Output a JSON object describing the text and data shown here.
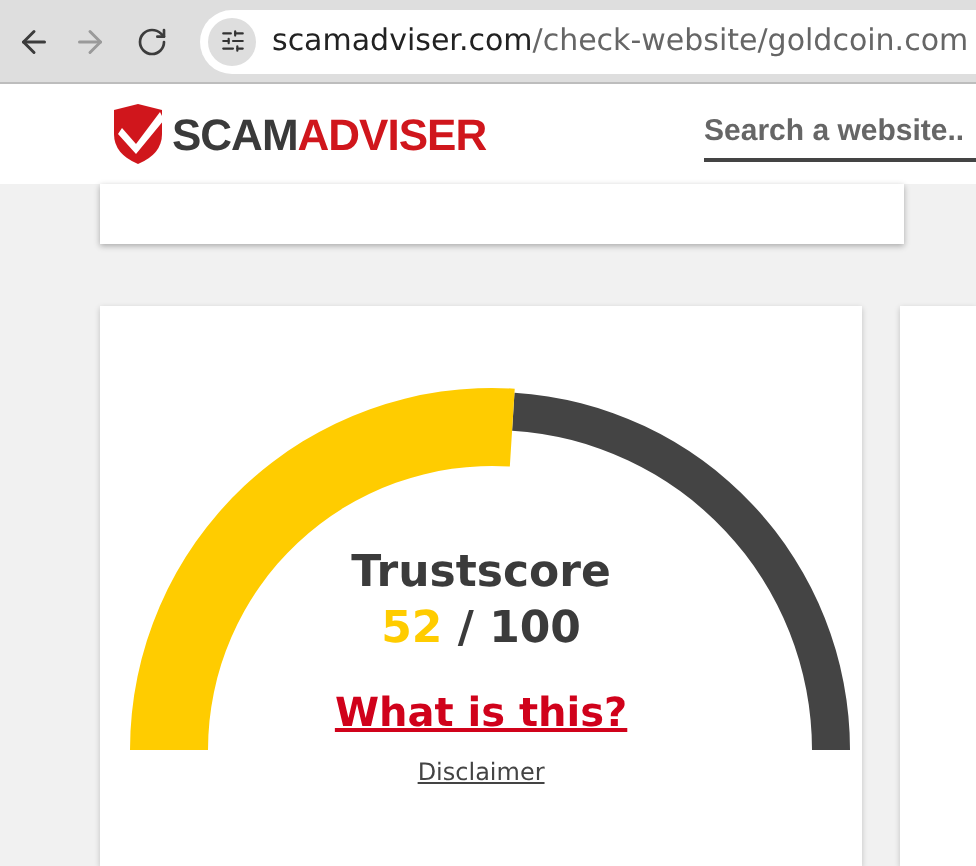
{
  "browser": {
    "url_host": "scamadviser.com",
    "url_path": "/check-website/goldcoin.com",
    "forward_disabled": true
  },
  "header": {
    "logo_part_1": "SCAM",
    "logo_part_2": "ADVISER",
    "search": {
      "placeholder": "Search a website.."
    }
  },
  "trust_card": {
    "title": "Trustscore",
    "score": "52",
    "max": "/ 100",
    "link": "What is this?",
    "disclaimer": "Disclaimer"
  }
}
